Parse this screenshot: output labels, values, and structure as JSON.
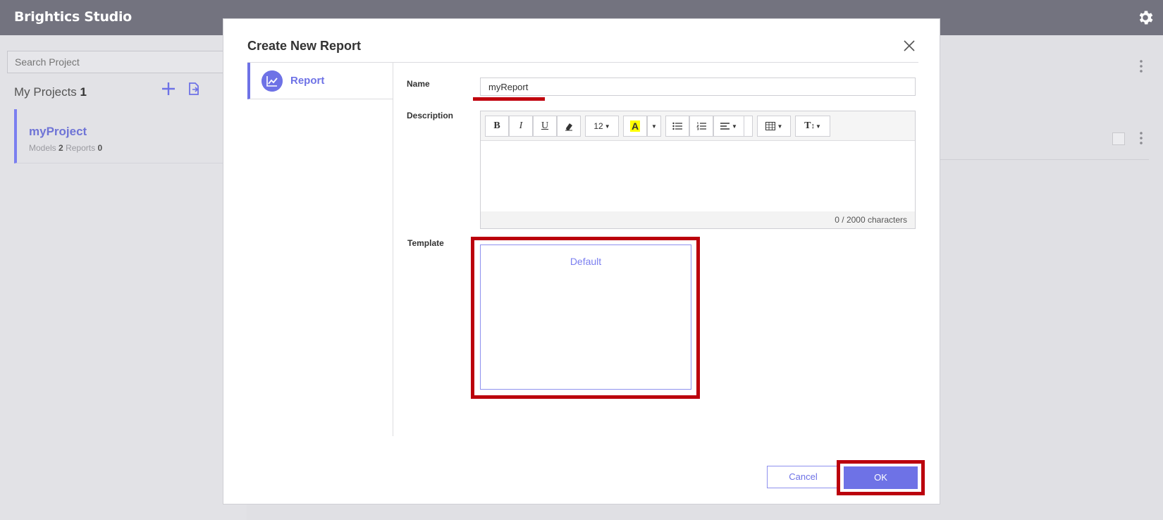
{
  "app": {
    "title": "Brightics Studio"
  },
  "sidebar": {
    "search_placeholder": "Search Project",
    "projects_label": "My Projects",
    "projects_count": "1",
    "project": {
      "name": "myProject",
      "models_label": "Models",
      "models_count": "2",
      "reports_label": "Reports",
      "reports_count": "0"
    }
  },
  "dialog": {
    "title": "Create New Report",
    "nav_item": "Report",
    "name_label": "Name",
    "name_value": "myReport",
    "description_label": "Description",
    "toolbar": {
      "bold": "B",
      "italic": "I",
      "underline": "U",
      "font_size": "12",
      "highlight": "A",
      "style": "T"
    },
    "char_count": "0 / 2000 characters",
    "template_label": "Template",
    "template_option": "Default",
    "cancel_label": "Cancel",
    "ok_label": "OK"
  },
  "colors": {
    "accent": "#6e72e6",
    "annotation": "#bb000d",
    "topbar": "#73737f"
  },
  "icons": [
    "gear-icon",
    "plus-icon",
    "file-import-icon",
    "close-icon",
    "report-chart-icon",
    "eraser-icon",
    "unordered-list-icon",
    "ordered-list-icon",
    "align-icon",
    "table-icon",
    "kebab-icon"
  ]
}
